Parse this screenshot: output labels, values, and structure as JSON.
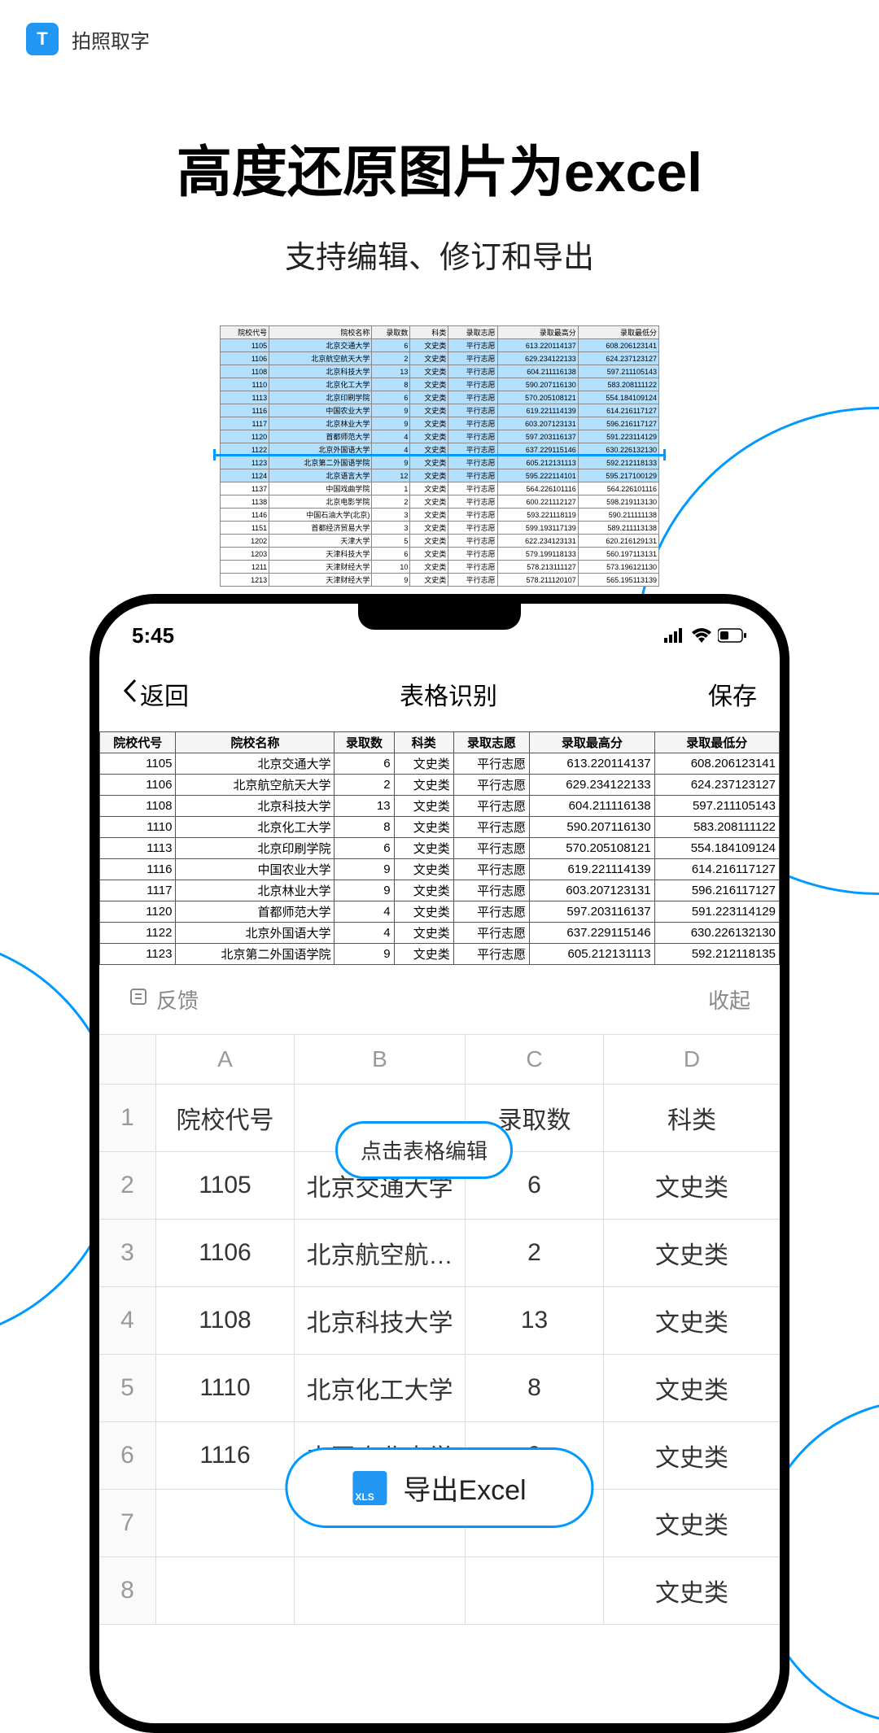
{
  "app": {
    "icon_letter": "T",
    "name": "拍照取字"
  },
  "hero": {
    "title": "高度还原图片为excel",
    "subtitle": "支持编辑、修订和导出"
  },
  "scan_headers": [
    "院校代号",
    "院校名称",
    "录取数",
    "科类",
    "录取志愿",
    "录取最高分",
    "录取最低分"
  ],
  "scan_rows": [
    [
      "1105",
      "北京交通大学",
      "6",
      "文史类",
      "平行志愿",
      "613.220114137",
      "608.206123141"
    ],
    [
      "1106",
      "北京航空航天大学",
      "2",
      "文史类",
      "平行志愿",
      "629.234122133",
      "624.237123127"
    ],
    [
      "1108",
      "北京科技大学",
      "13",
      "文史类",
      "平行志愿",
      "604.211116138",
      "597.211105143"
    ],
    [
      "1110",
      "北京化工大学",
      "8",
      "文史类",
      "平行志愿",
      "590.207116130",
      "583.208111122"
    ],
    [
      "1113",
      "北京印刷学院",
      "6",
      "文史类",
      "平行志愿",
      "570.205108121",
      "554.184109124"
    ],
    [
      "1116",
      "中国农业大学",
      "9",
      "文史类",
      "平行志愿",
      "619.221114139",
      "614.216117127"
    ],
    [
      "1117",
      "北京林业大学",
      "9",
      "文史类",
      "平行志愿",
      "603.207123131",
      "596.216117127"
    ],
    [
      "1120",
      "首都师范大学",
      "4",
      "文史类",
      "平行志愿",
      "597.203116137",
      "591.223114129"
    ],
    [
      "1122",
      "北京外国语大学",
      "4",
      "文史类",
      "平行志愿",
      "637.229115146",
      "630.226132130"
    ],
    [
      "1123",
      "北京第二外国语学院",
      "9",
      "文史类",
      "平行志愿",
      "605.212131113",
      "592.212118133"
    ],
    [
      "1124",
      "北京语言大学",
      "12",
      "文史类",
      "平行志愿",
      "595.222114101",
      "595.217100129"
    ],
    [
      "1137",
      "中国戏曲学院",
      "1",
      "文史类",
      "平行志愿",
      "564.226101116",
      "564.226101116"
    ],
    [
      "1138",
      "北京电影学院",
      "2",
      "文史类",
      "平行志愿",
      "600.221112127",
      "598.219113130"
    ],
    [
      "1146",
      "中国石油大学(北京)",
      "3",
      "文史类",
      "平行志愿",
      "593.221118119",
      "590.211111138"
    ],
    [
      "1151",
      "首都经济贸易大学",
      "3",
      "文史类",
      "平行志愿",
      "599.193117139",
      "589.211113138"
    ],
    [
      "1202",
      "天津大学",
      "5",
      "文史类",
      "平行志愿",
      "622.234123131",
      "620.216129131"
    ],
    [
      "1203",
      "天津科技大学",
      "6",
      "文史类",
      "平行志愿",
      "579.199118133",
      "560.197113131"
    ],
    [
      "1211",
      "天津财经大学",
      "10",
      "文史类",
      "平行志愿",
      "578.213111127",
      "573.196121130"
    ],
    [
      "1213",
      "天津财经大学",
      "9",
      "文史类",
      "平行志愿",
      "578.211120107",
      "565.195113139"
    ]
  ],
  "phone": {
    "time": "5:45",
    "nav": {
      "back": "返回",
      "title": "表格识别",
      "save": "保存"
    },
    "feedback": {
      "label": "反馈",
      "collapse": "收起"
    },
    "edit_hint": "点击表格编辑",
    "export_label": "导出Excel",
    "xls_label": "XLS"
  },
  "detected_headers": [
    "院校代号",
    "院校名称",
    "录取数",
    "科类",
    "录取志愿",
    "录取最高分",
    "录取最低分"
  ],
  "detected_rows": [
    [
      "1105",
      "北京交通大学",
      "6",
      "文史类",
      "平行志愿",
      "613.220114137",
      "608.206123141"
    ],
    [
      "1106",
      "北京航空航天大学",
      "2",
      "文史类",
      "平行志愿",
      "629.234122133",
      "624.237123127"
    ],
    [
      "1108",
      "北京科技大学",
      "13",
      "文史类",
      "平行志愿",
      "604.211116138",
      "597.211105143"
    ],
    [
      "1110",
      "北京化工大学",
      "8",
      "文史类",
      "平行志愿",
      "590.207116130",
      "583.208111122"
    ],
    [
      "1113",
      "北京印刷学院",
      "6",
      "文史类",
      "平行志愿",
      "570.205108121",
      "554.184109124"
    ],
    [
      "1116",
      "中国农业大学",
      "9",
      "文史类",
      "平行志愿",
      "619.221114139",
      "614.216117127"
    ],
    [
      "1117",
      "北京林业大学",
      "9",
      "文史类",
      "平行志愿",
      "603.207123131",
      "596.216117127"
    ],
    [
      "1120",
      "首都师范大学",
      "4",
      "文史类",
      "平行志愿",
      "597.203116137",
      "591.223114129"
    ],
    [
      "1122",
      "北京外国语大学",
      "4",
      "文史类",
      "平行志愿",
      "637.229115146",
      "630.226132130"
    ],
    [
      "1123",
      "北京第二外国语学院",
      "9",
      "文史类",
      "平行志愿",
      "605.212131113",
      "592.212118135"
    ]
  ],
  "sheet": {
    "col_headers": [
      "A",
      "B",
      "C",
      "D"
    ],
    "row_labels": [
      "院校代号",
      "",
      "录取数",
      "科类"
    ],
    "rows": [
      [
        "1",
        "1105",
        "北京交通大学",
        "6",
        "文史类"
      ],
      [
        "2",
        "1106",
        "北京航空航…",
        "2",
        "文史类"
      ],
      [
        "3",
        "1108",
        "北京科技大学",
        "13",
        "文史类"
      ],
      [
        "4",
        "1110",
        "北京化工大学",
        "8",
        "文史类"
      ],
      [
        "5",
        "1116",
        "中国农业大学",
        "9",
        "文史类"
      ],
      [
        "6",
        "",
        "",
        "",
        "文史类"
      ],
      [
        "7",
        "",
        "",
        "",
        "文史类"
      ]
    ]
  }
}
